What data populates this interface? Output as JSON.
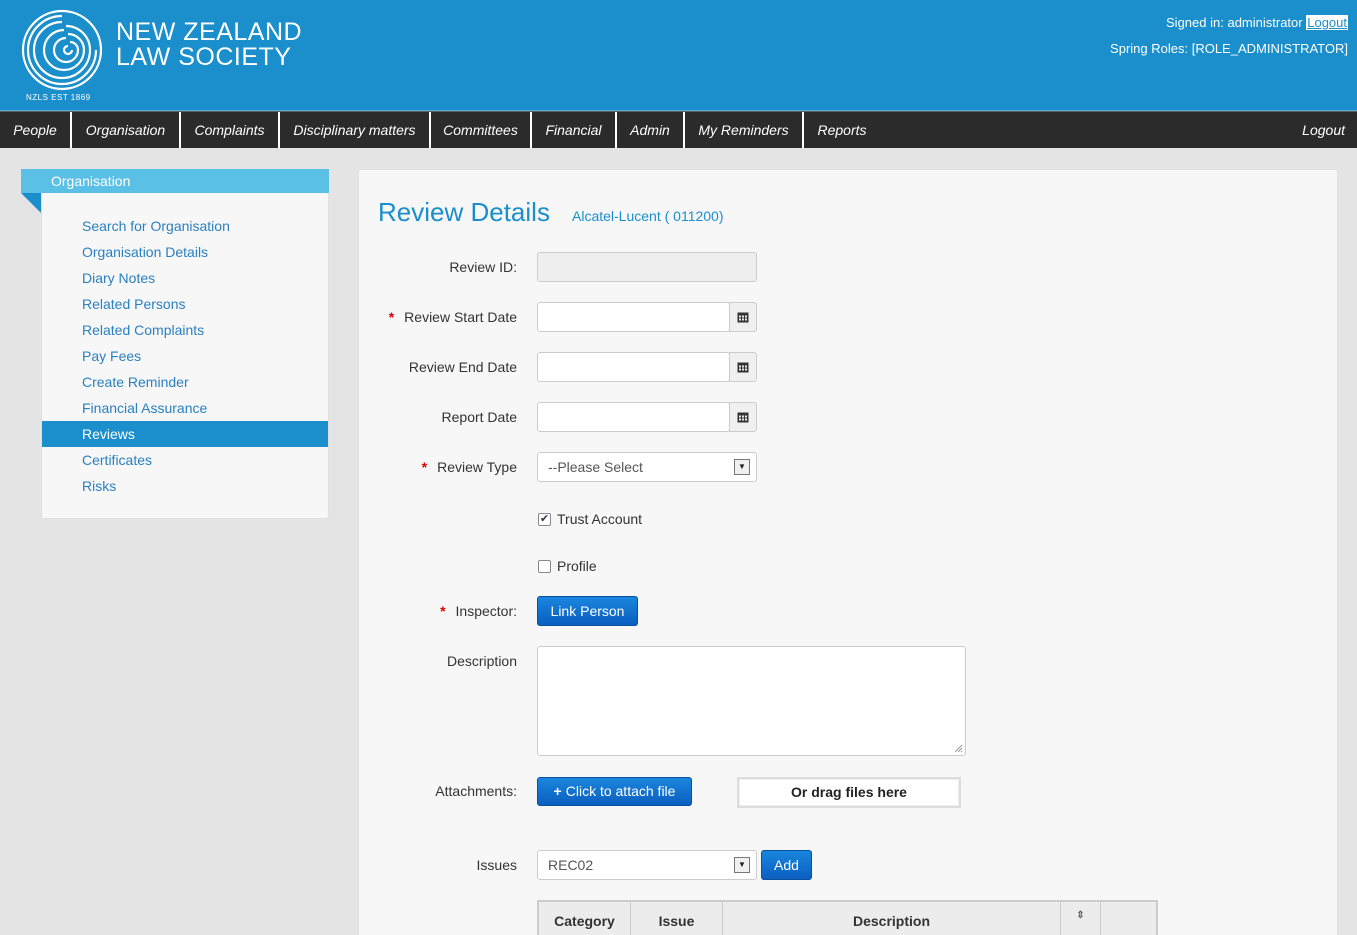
{
  "header": {
    "logo_line1": "NEW ZEALAND",
    "logo_line2": "LAW SOCIETY",
    "logo_est": "NZLS EST 1869",
    "signed_in_label": "Signed in:",
    "signed_in_user": "administrator",
    "logout_link": "Logout",
    "roles_label": "Spring Roles:",
    "roles_value": "[ROLE_ADMINISTRATOR]"
  },
  "nav": {
    "items": [
      "People",
      "Organisation",
      "Complaints",
      "Disciplinary matters",
      "Committees",
      "Financial",
      "Admin",
      "My Reminders",
      "Reports"
    ],
    "logout": "Logout"
  },
  "sidebar": {
    "title": "Organisation",
    "items": [
      {
        "label": "Search for Organisation",
        "active": false
      },
      {
        "label": "Organisation Details",
        "active": false
      },
      {
        "label": "Diary Notes",
        "active": false
      },
      {
        "label": "Related Persons",
        "active": false
      },
      {
        "label": "Related Complaints",
        "active": false
      },
      {
        "label": "Pay Fees",
        "active": false
      },
      {
        "label": "Create Reminder",
        "active": false
      },
      {
        "label": "Financial Assurance",
        "active": false
      },
      {
        "label": "Reviews",
        "active": true
      },
      {
        "label": "Certificates",
        "active": false
      },
      {
        "label": "Risks",
        "active": false
      }
    ]
  },
  "main": {
    "title": "Review Details",
    "subtitle": "Alcatel-Lucent ( 011200)",
    "form": {
      "review_id_label": "Review ID:",
      "review_id_value": "",
      "start_date_label": "Review Start Date",
      "start_date_value": "",
      "end_date_label": "Review End Date",
      "end_date_value": "",
      "report_date_label": "Report Date",
      "report_date_value": "",
      "review_type_label": "Review Type",
      "review_type_value": "--Please Select",
      "trust_account_label": "Trust Account",
      "trust_account_checked": true,
      "profile_label": "Profile",
      "profile_checked": false,
      "inspector_label": "Inspector:",
      "link_person_button": "Link Person",
      "description_label": "Description",
      "description_value": "",
      "attachments_label": "Attachments:",
      "attach_button": "Click to attach file",
      "drop_zone": "Or drag files here",
      "issues_label": "Issues",
      "issues_value": "REC02",
      "add_button": "Add"
    },
    "table": {
      "headers": [
        "Category",
        "Issue",
        "Description",
        ""
      ]
    }
  },
  "colors": {
    "header_bg": "#1a8fcc",
    "nav_bg": "#2b2b2b",
    "accent": "#1a8fcc",
    "required": "#dd0000"
  }
}
